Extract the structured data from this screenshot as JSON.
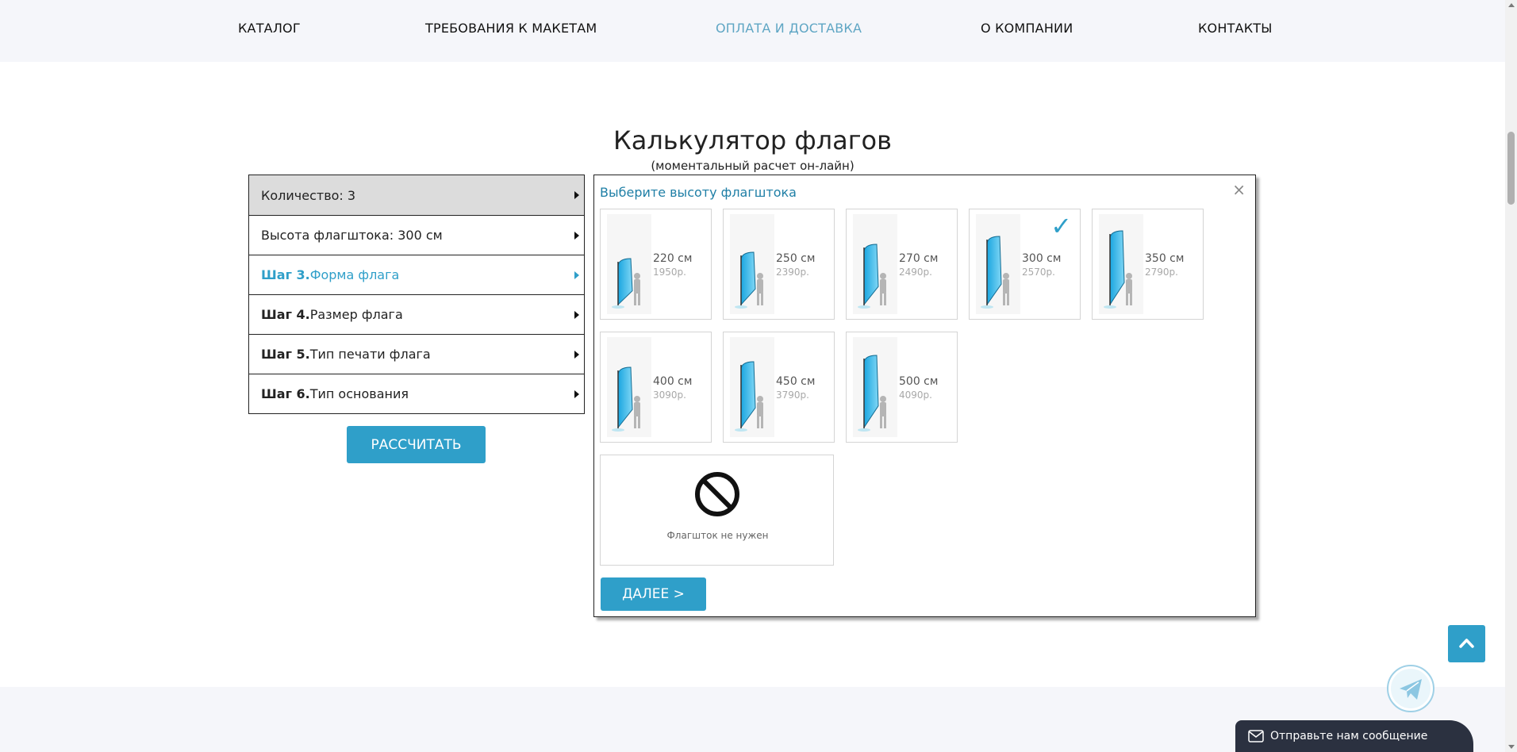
{
  "nav": {
    "items": [
      {
        "label": "КАТАЛОГ",
        "active": false
      },
      {
        "label": "ТРЕБОВАНИЯ К МАКЕТАМ",
        "active": false
      },
      {
        "label": "ОПЛАТА И ДОСТАВКА",
        "active": true
      },
      {
        "label": "О КОМПАНИИ",
        "active": false
      },
      {
        "label": "КОНТАКТЫ",
        "active": false
      }
    ]
  },
  "calculator": {
    "title": "Калькулятор флагов",
    "subtitle": "(моментальный расчет он-лайн)",
    "steps": [
      {
        "num": "",
        "label": "Количество: 3"
      },
      {
        "num": "",
        "label": "Высота флагштока: 300 см"
      },
      {
        "num": "Шаг 3.",
        "label": "Форма флага"
      },
      {
        "num": "Шаг 4.",
        "label": "Размер флага"
      },
      {
        "num": "Шаг 5.",
        "label": "Тип печати флага"
      },
      {
        "num": "Шаг 6.",
        "label": "Тип основания"
      }
    ],
    "calc_button": "РАССЧИТАТЬ"
  },
  "panel": {
    "title": "Выберите высоту флагштока",
    "close": "×",
    "options": [
      {
        "size": "220 см",
        "price": "1950р.",
        "selected": false
      },
      {
        "size": "250 см",
        "price": "2390р.",
        "selected": false
      },
      {
        "size": "270 см",
        "price": "2490р.",
        "selected": false
      },
      {
        "size": "300 см",
        "price": "2570р.",
        "selected": true
      },
      {
        "size": "350 см",
        "price": "2790р.",
        "selected": false
      },
      {
        "size": "400 см",
        "price": "3090р.",
        "selected": false
      },
      {
        "size": "450 см",
        "price": "3790р.",
        "selected": false
      },
      {
        "size": "500 см",
        "price": "4090р.",
        "selected": false
      }
    ],
    "none_option": "Флагшток не нужен",
    "next_button": "ДАЛЕЕ >"
  },
  "widgets": {
    "chat_label": "Отправьте нам сообщение"
  },
  "colors": {
    "accent": "#2f9fc9",
    "nav_active": "#5fa6c4",
    "panel_title": "#1f7fa6",
    "chat_bg": "#2b3140"
  }
}
